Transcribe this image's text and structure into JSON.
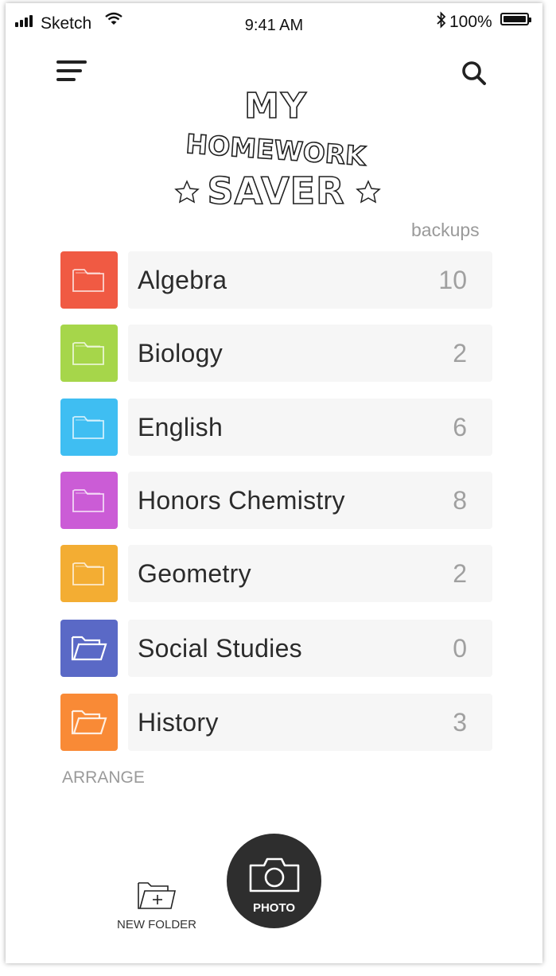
{
  "status_bar": {
    "carrier": "Sketch",
    "time": "9:41 AM",
    "bluetooth_icon": "bluetooth-icon",
    "battery": "100%"
  },
  "nav": {
    "menu_icon": "hamburger-menu-icon",
    "search_icon": "search-icon"
  },
  "logo": {
    "line1": "MY",
    "line2": "HOMEWORK",
    "line3": "SAVER"
  },
  "list": {
    "column_header": "backups",
    "folders": [
      {
        "name": "Algebra",
        "count": "10",
        "color": "#f05a43"
      },
      {
        "name": "Biology",
        "count": "2",
        "color": "#a6d64a"
      },
      {
        "name": "English",
        "count": "6",
        "color": "#3fbef2"
      },
      {
        "name": "Honors Chemistry",
        "count": "8",
        "color": "#cb5cd6"
      },
      {
        "name": "Geometry",
        "count": "2",
        "color": "#f3ad33"
      },
      {
        "name": "Social Studies",
        "count": "0",
        "color": "#5a69c6"
      },
      {
        "name": "History",
        "count": "3",
        "color": "#f98a36"
      }
    ]
  },
  "arrange_label": "ARRANGE",
  "toolbar": {
    "new_folder_label": "NEW FOLDER",
    "photo_label": "PHOTO"
  },
  "colors": {
    "photo_button_bg": "#2e2e2e",
    "row_bg": "#f6f6f6"
  }
}
